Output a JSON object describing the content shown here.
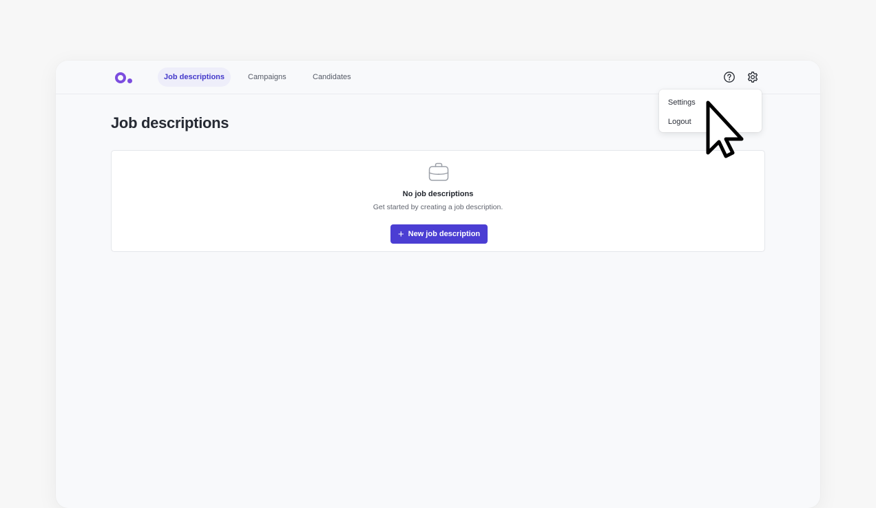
{
  "nav": {
    "tabs": [
      {
        "label": "Job descriptions",
        "active": true
      },
      {
        "label": "Campaigns",
        "active": false
      },
      {
        "label": "Candidates",
        "active": false
      }
    ],
    "icons": [
      "help-circle-icon",
      "gear-icon"
    ]
  },
  "dropdown": {
    "items": [
      {
        "label": "Settings"
      },
      {
        "label": "Logout"
      }
    ]
  },
  "page": {
    "title": "Job descriptions"
  },
  "empty_state": {
    "icon": "briefcase-icon",
    "title": "No job descriptions",
    "subtitle": "Get started by creating a job description.",
    "button_label": "New job description",
    "button_icon": "plus-icon"
  },
  "colors": {
    "brand": "#7c4ddf",
    "primary_button": "#4b3ed3",
    "active_tab_bg": "#eeeefa",
    "active_tab_text": "#4338ca"
  }
}
